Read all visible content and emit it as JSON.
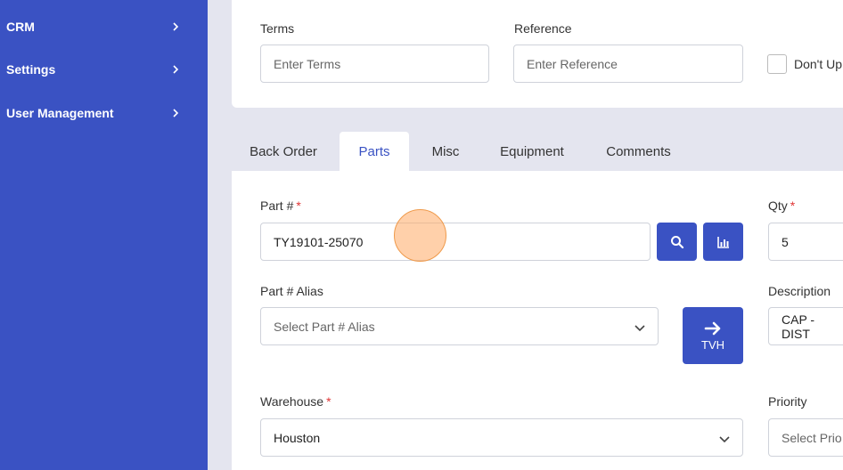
{
  "sidebar": {
    "items": [
      {
        "label": "CRM"
      },
      {
        "label": "Settings"
      },
      {
        "label": "User Management"
      }
    ]
  },
  "header_form": {
    "terms_label": "Terms",
    "terms_placeholder": "Enter Terms",
    "reference_label": "Reference",
    "reference_placeholder": "Enter Reference",
    "dont_update_label": "Don't Up"
  },
  "tabs": [
    {
      "label": "Back Order"
    },
    {
      "label": "Parts"
    },
    {
      "label": "Misc"
    },
    {
      "label": "Equipment"
    },
    {
      "label": "Comments"
    }
  ],
  "active_tab": "Parts",
  "parts_form": {
    "part_label": "Part #",
    "part_value": "TY19101-25070",
    "qty_label": "Qty",
    "qty_value": "5",
    "alias_label": "Part # Alias",
    "alias_placeholder": "Select Part # Alias",
    "tvh_label": "TVH",
    "description_label": "Description",
    "description_value": "CAP - DIST",
    "warehouse_label": "Warehouse",
    "warehouse_value": "Houston",
    "priority_label": "Priority",
    "priority_placeholder": "Select Prio",
    "required_mark": "*"
  },
  "colors": {
    "sidebar": "#3a52c3",
    "accent": "#3a52c3",
    "required": "#e03535"
  }
}
